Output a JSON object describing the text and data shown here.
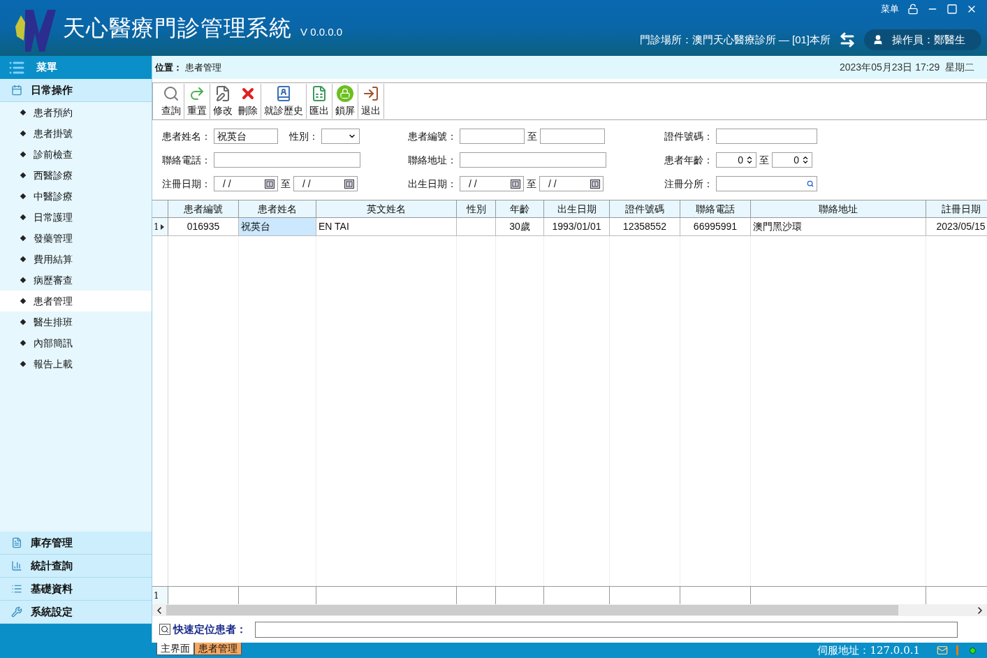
{
  "header": {
    "title": "天心醫療門診管理系統",
    "version": "V 0.0.0.0",
    "menu_label": "菜单",
    "clinic": "門診場所：澳門天心醫療診所 — [01]本所",
    "operator": "操作員：鄭醫生"
  },
  "sidebar": {
    "title": "菜單",
    "sections": [
      {
        "label": "日常操作",
        "items": [
          {
            "label": "患者預約",
            "selected": false
          },
          {
            "label": "患者掛號",
            "selected": false
          },
          {
            "label": "診前檢查",
            "selected": false
          },
          {
            "label": "西醫診療",
            "selected": false
          },
          {
            "label": "中醫診療",
            "selected": false
          },
          {
            "label": "日常護理",
            "selected": false
          },
          {
            "label": "發藥管理",
            "selected": false
          },
          {
            "label": "費用結算",
            "selected": false
          },
          {
            "label": "病歷審查",
            "selected": false
          },
          {
            "label": "患者管理",
            "selected": true
          },
          {
            "label": "醫生排班",
            "selected": false
          },
          {
            "label": "內部簡訊",
            "selected": false
          },
          {
            "label": "報告上載",
            "selected": false
          }
        ]
      },
      {
        "label": "庫存管理"
      },
      {
        "label": "統計查詢"
      },
      {
        "label": "基礎資料"
      },
      {
        "label": "系統設定"
      }
    ]
  },
  "breadcrumb": {
    "label": "位置：",
    "value": "患者管理",
    "datetime": "2023年05月23日 17:29  星期二"
  },
  "toolbar": [
    [
      "查詢"
    ],
    [
      "重置"
    ],
    [
      "修改",
      "刪除"
    ],
    [
      "就診歷史"
    ],
    [
      "匯出"
    ],
    [
      "鎖屏"
    ],
    [
      "退出"
    ]
  ],
  "search_form": {
    "rows": [
      {
        "groups": [
          [
            {
              "kind": "text",
              "label": "患者姓名：",
              "value": "祝英台"
            },
            {
              "kind": "select",
              "label": "性別："
            }
          ],
          [
            {
              "kind": "text_range",
              "label": "患者編號：",
              "separator": "至"
            }
          ],
          [
            {
              "kind": "text",
              "label": "證件號碼："
            }
          ]
        ]
      },
      {
        "groups": [
          [
            {
              "kind": "text",
              "label": "聯絡電話：",
              "wide": true
            }
          ],
          [
            {
              "kind": "text",
              "label": "聯絡地址：",
              "wide": true
            }
          ],
          [
            {
              "kind": "number_range",
              "label": "患者年齡：",
              "from": "0",
              "to": "0",
              "separator": "至"
            }
          ]
        ]
      },
      {
        "groups": [
          [
            {
              "kind": "date_range",
              "label": "注冊日期：",
              "from": "/ /",
              "to": "/ /",
              "separator": "至"
            }
          ],
          [
            {
              "kind": "date_range",
              "label": "出生日期：",
              "from": "/ /",
              "to": "/ /",
              "separator": "至"
            }
          ],
          [
            {
              "kind": "lookup",
              "label": "注冊分所："
            }
          ]
        ]
      }
    ]
  },
  "table": {
    "columns": [
      "患者編號",
      "患者姓名",
      "英文姓名",
      "性別",
      "年齡",
      "出生日期",
      "證件號碼",
      "聯絡電話",
      "聯絡地址",
      "註冊日期"
    ],
    "rows": [
      {
        "number": "1",
        "current": true,
        "cells": [
          {
            "text": "016935",
            "focused": false
          },
          {
            "text": "祝英台",
            "focused": true
          },
          {
            "text": "EN TAI",
            "focused": false
          },
          {
            "text": "",
            "focused": false
          },
          {
            "text": "30歲",
            "focused": false
          },
          {
            "text": "1993/01/01",
            "focused": false
          },
          {
            "text": "12358552",
            "focused": false
          },
          {
            "text": "66995991",
            "focused": false
          },
          {
            "text": "澳門黑沙環",
            "focused": false
          },
          {
            "text": "2023/05/15",
            "focused": false
          }
        ]
      }
    ],
    "summary_row": {
      "number": "1"
    }
  },
  "quick_locate": {
    "label": "快速定位患者："
  },
  "status_bar": {
    "tabs": [
      {
        "label": "主界面",
        "selected": false
      },
      {
        "label": "患者管理",
        "selected": true
      }
    ],
    "server": "伺服地址：127.0.0.1"
  }
}
